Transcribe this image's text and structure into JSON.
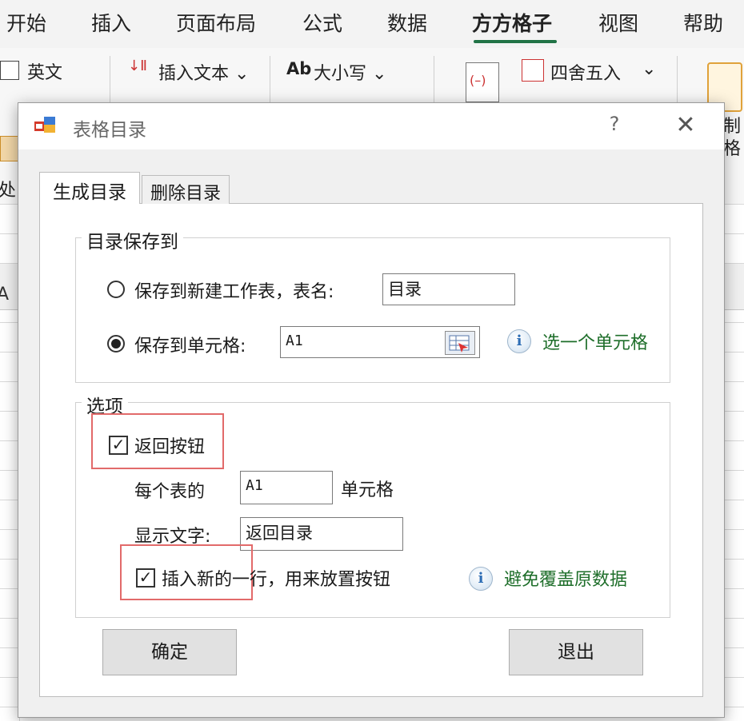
{
  "ribbon": {
    "tabs": [
      "开始",
      "插入",
      "页面布局",
      "公式",
      "数据",
      "方方格子",
      "视图",
      "帮助"
    ],
    "active_tab": "方方格子",
    "items": {
      "english": "英文",
      "insert_text": "插入文本 ⌄",
      "case": "大小写 ⌄",
      "case_prefix": "Ab",
      "round": "四舍五入",
      "round_caret": "⌄",
      "cut_left": "处",
      "cut_right": "制",
      "cut_right2": "格"
    },
    "column_header": "A"
  },
  "dialog": {
    "title": "表格目录",
    "help": "?",
    "close": "✕",
    "tabs": [
      "生成目录",
      "删除目录"
    ],
    "save_group": {
      "legend": "目录保存到",
      "option_new_sheet": "保存到新建工作表，表名:",
      "sheet_name_value": "目录",
      "option_cell": "保存到单元格:",
      "cell_value": "A1",
      "hint": "选一个单元格"
    },
    "options_group": {
      "legend": "选项",
      "return_button_label": "返回按钮",
      "each_sheet_label": "每个表的",
      "each_sheet_cell_value": "A1",
      "cell_suffix": "单元格",
      "display_text_label": "显示文字:",
      "display_text_value": "返回目录",
      "insert_row_label": "插入新的一行，用来放置按钮",
      "hint": "避免覆盖原数据"
    },
    "ok": "确定",
    "exit": "退出"
  }
}
